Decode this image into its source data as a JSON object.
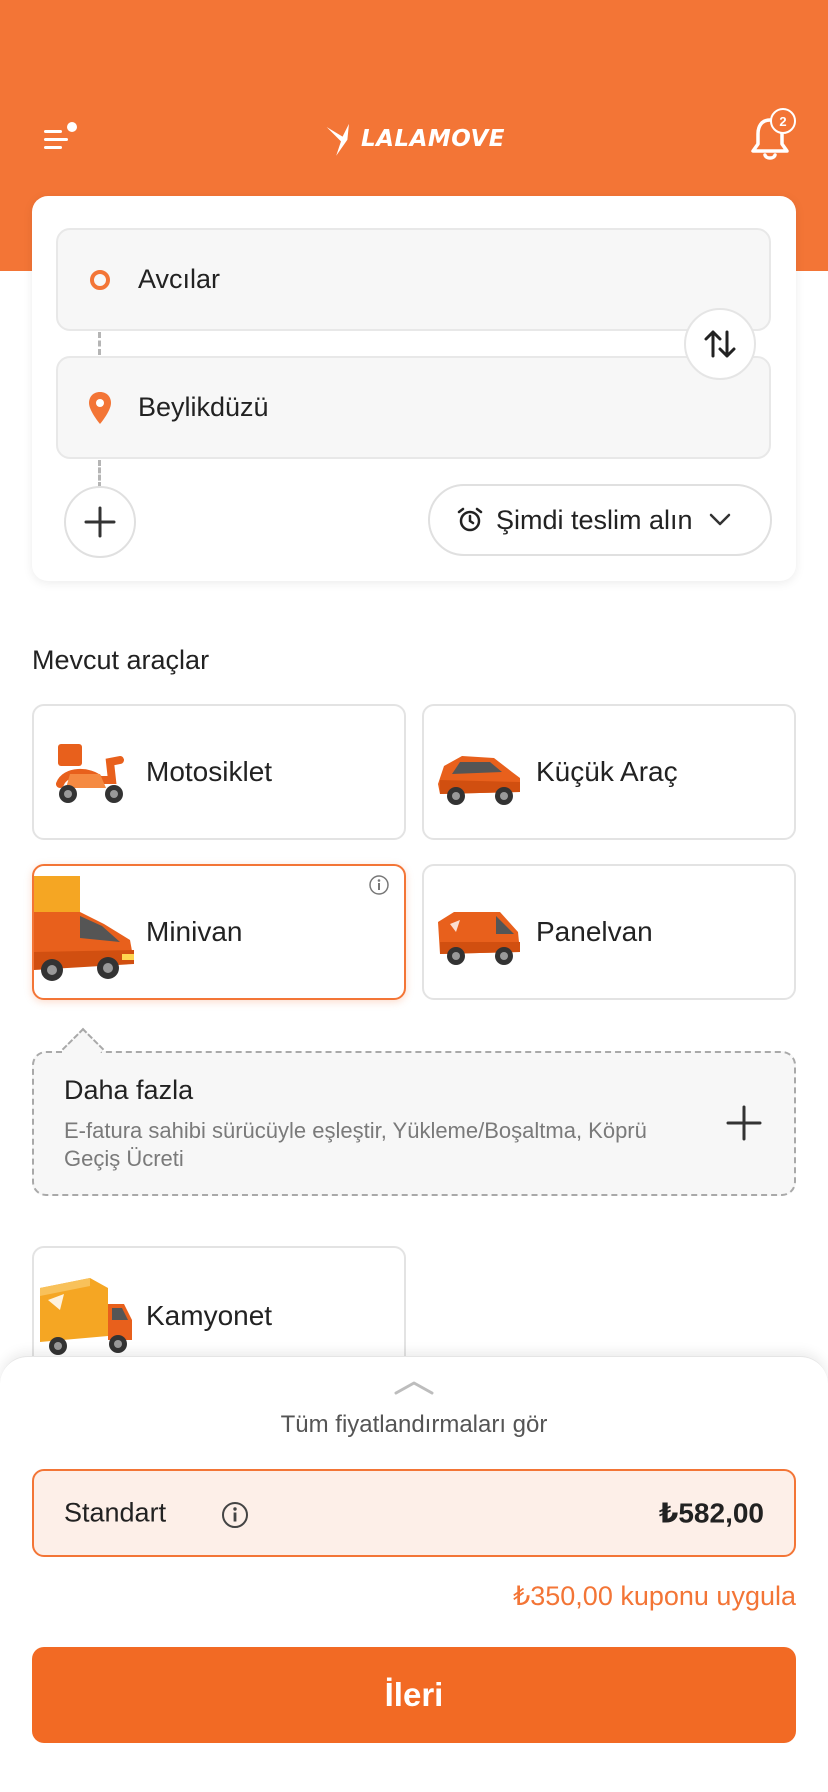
{
  "header": {
    "logo_text": "LALAMOVE",
    "notification_count": "2"
  },
  "route": {
    "pickup": "Avcılar",
    "dropoff": "Beylikdüzü",
    "time_label": "Şimdi teslim alın"
  },
  "vehicles": {
    "section_title": "Mevcut araçlar",
    "items": [
      {
        "label": "Motosiklet",
        "icon": "motorcycle-icon"
      },
      {
        "label": "Küçük Araç",
        "icon": "small-car-icon"
      },
      {
        "label": "Minivan",
        "icon": "minivan-icon",
        "selected": true
      },
      {
        "label": "Panelvan",
        "icon": "panelvan-icon"
      },
      {
        "label": "Kamyonet",
        "icon": "truck-icon"
      }
    ]
  },
  "more": {
    "title": "Daha fazla",
    "description": "E-fatura sahibi sürücüyle eşleştir, Yükleme/Boşaltma, Köprü Geçiş Ücreti"
  },
  "pricing": {
    "see_all": "Tüm fiyatlandırmaları gör",
    "tier_label": "Standart",
    "price": "₺582,00",
    "coupon": "₺350,00 kuponu uygula",
    "next_label": "İleri"
  },
  "colors": {
    "brand": "#F37536",
    "button": "#F26A24",
    "selected_bg": "#FDEFE8"
  }
}
